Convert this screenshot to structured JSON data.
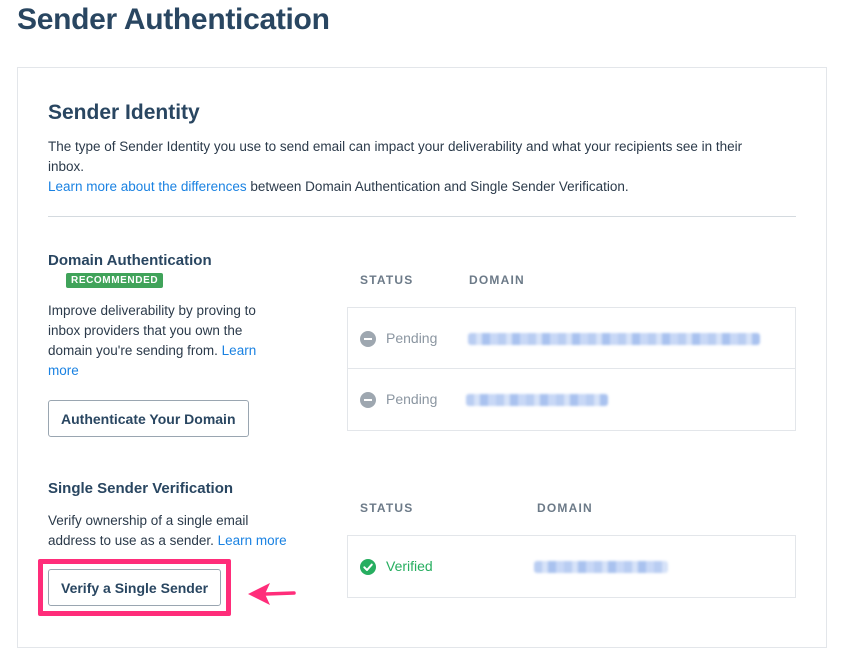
{
  "page": {
    "title": "Sender Authentication"
  },
  "sender_identity": {
    "title": "Sender Identity",
    "intro": "The type of Sender Identity you use to send email can impact your deliverability and what your recipients see in their inbox.",
    "learn_more_link": "Learn more about the differences",
    "learn_more_suffix": " between Domain Authentication and Single Sender Verification."
  },
  "domain_auth": {
    "title": "Domain Authentication",
    "badge": "RECOMMENDED",
    "description": "Improve deliverability by proving to inbox providers that you own the domain you're sending from. ",
    "learn_more": "Learn more",
    "button": "Authenticate Your Domain",
    "columns": {
      "status": "STATUS",
      "domain": "DOMAIN"
    },
    "rows": [
      {
        "status": "Pending",
        "status_icon": "minus-circle-icon"
      },
      {
        "status": "Pending",
        "status_icon": "minus-circle-icon"
      }
    ]
  },
  "single_sender": {
    "title": "Single Sender Verification",
    "description": "Verify ownership of a single email address to use as a sender. ",
    "learn_more": "Learn more",
    "button": "Verify a Single Sender",
    "columns": {
      "status": "STATUS",
      "domain": "DOMAIN"
    },
    "rows": [
      {
        "status": "Verified",
        "status_icon": "check-circle-icon"
      }
    ]
  },
  "colors": {
    "accent_link": "#1a82e2",
    "badge": "#40a35a",
    "verified": "#27ae60",
    "highlight": "#ff2d7a"
  }
}
